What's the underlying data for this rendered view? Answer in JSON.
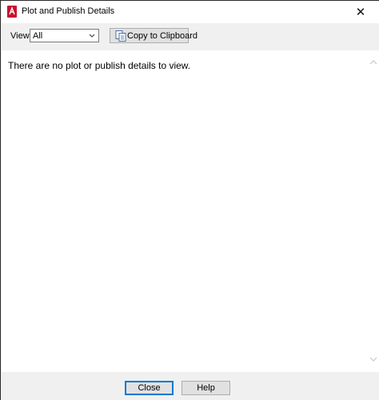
{
  "window": {
    "title": "Plot and Publish Details",
    "close_glyph": "✕"
  },
  "toolbar": {
    "view_label": "View:",
    "view_value": "All",
    "copy_label": "Copy to Clipboard"
  },
  "content": {
    "message": "There are no plot or publish details to view."
  },
  "footer": {
    "close_label": "Close",
    "help_label": "Help"
  },
  "icons": {
    "app": "autocad-app-icon",
    "dropdown": "chevron-down-icon",
    "copy": "copy-icon",
    "scroll_up": "scroll-up-arrow-icon",
    "scroll_down": "scroll-down-arrow-icon"
  },
  "colors": {
    "app_icon": "#c8102e",
    "default_button_border": "#0078d7"
  }
}
